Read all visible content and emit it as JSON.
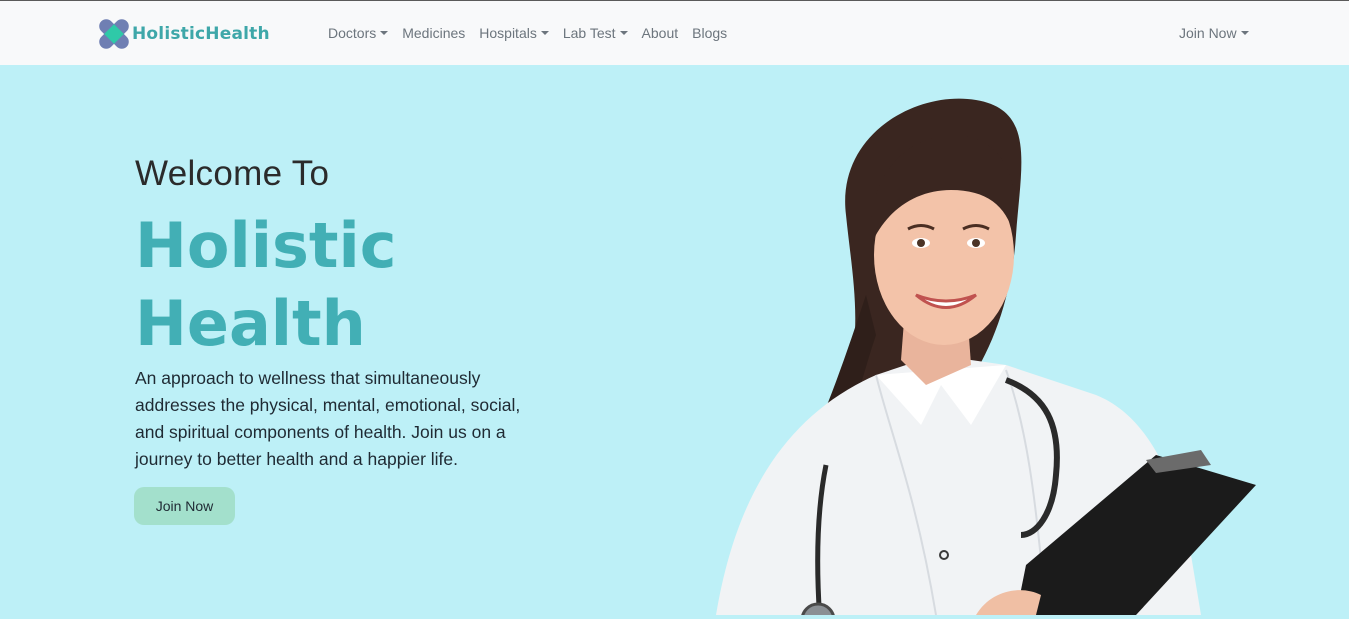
{
  "navbar": {
    "brand": "HolisticHealth",
    "items": [
      {
        "label": "Doctors",
        "dropdown": true
      },
      {
        "label": "Medicines",
        "dropdown": false
      },
      {
        "label": "Hospitals",
        "dropdown": true
      },
      {
        "label": "Lab Test",
        "dropdown": true
      },
      {
        "label": "About",
        "dropdown": false
      },
      {
        "label": "Blogs",
        "dropdown": false
      }
    ],
    "join_label": "Join Now"
  },
  "hero": {
    "welcome": "Welcome To",
    "title_line1": "Holistic",
    "title_line2": "Health",
    "description": "An approach to wellness that simultaneously addresses the physical, mental, emotional, social, and spiritual components of health. Join us on a journey to better health and a happier life.",
    "cta_label": "Join Now"
  },
  "colors": {
    "hero_background": "#bdf0f7",
    "brand_accent": "#42afb5",
    "button_background": "#a3e0cc",
    "navbar_background": "#f8f9fa"
  },
  "icons": {
    "brand_logo": "cross-logo-icon",
    "dropdown": "caret-down-icon"
  }
}
